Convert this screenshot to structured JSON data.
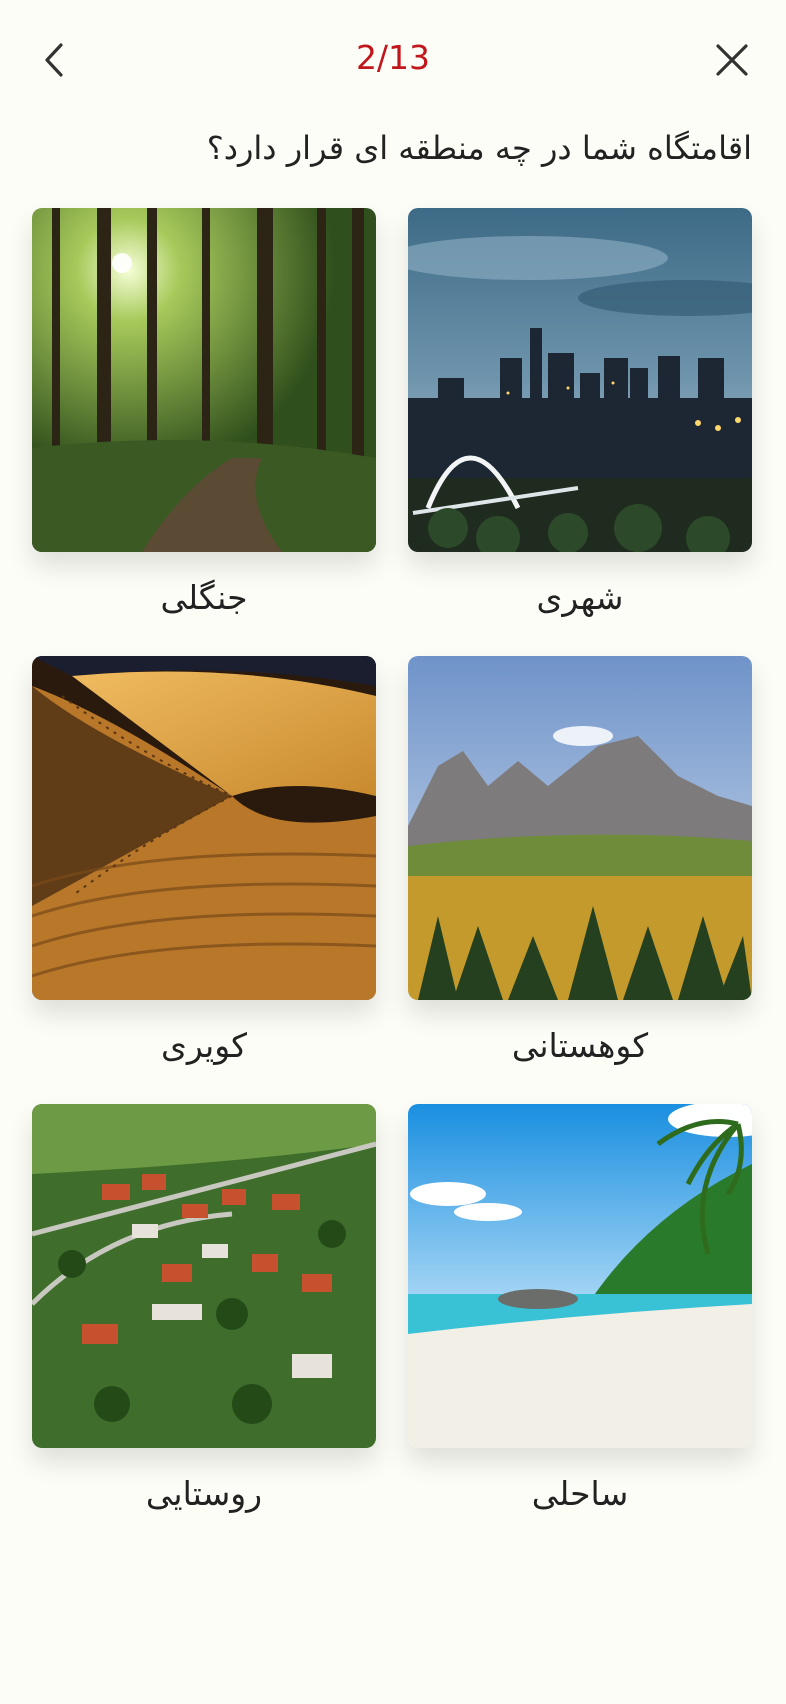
{
  "header": {
    "step": "2/13",
    "back_icon": "chevron-left-icon",
    "close_icon": "close-icon",
    "accent": "#c0161c"
  },
  "question": "اقامتگاه شما در چه منطقه ای قرار دارد؟",
  "options": [
    {
      "label": "شهری",
      "image": "city-skyline-image"
    },
    {
      "label": "جنگلی",
      "image": "forest-image"
    },
    {
      "label": "کوهستانی",
      "image": "mountain-image"
    },
    {
      "label": "کویری",
      "image": "desert-dunes-image"
    },
    {
      "label": "ساحلی",
      "image": "beach-image"
    },
    {
      "label": "روستایی",
      "image": "village-aerial-image"
    }
  ]
}
